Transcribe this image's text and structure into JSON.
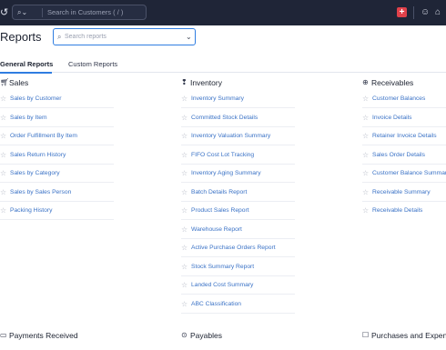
{
  "topbar": {
    "logo_icon": "app-logo-icon",
    "search_scope_icon": "search-icon",
    "search_placeholder": "Search in Customers ( / )",
    "add_label": "+",
    "users_icon": "users-icon",
    "bell_icon": "bell-icon"
  },
  "header": {
    "title": "Reports",
    "search_placeholder": "Search reports"
  },
  "tabs": [
    {
      "label": "General Reports",
      "active": true
    },
    {
      "label": "Custom Reports",
      "active": false
    }
  ],
  "sections": {
    "sales": {
      "title": "Sales",
      "icon": "cart-icon",
      "items": [
        "Sales by Customer",
        "Sales by Item",
        "Order Fulfillment By Item",
        "Sales Return History",
        "Sales by Category",
        "Sales by Sales Person",
        "Packing History"
      ]
    },
    "inventory": {
      "title": "Inventory",
      "icon": "tag-icon",
      "items": [
        "Inventory Summary",
        "Committed Stock Details",
        "Inventory Valuation Summary",
        "FIFO Cost Lot Tracking",
        "Inventory Aging Summary",
        "Batch Details Report",
        "Product Sales Report",
        "Warehouse Report",
        "Active Purchase Orders Report",
        "Stock Summary Report",
        "Landed Cost Summary",
        "ABC Classification"
      ]
    },
    "receivables": {
      "title": "Receivables",
      "icon": "receivables-icon",
      "items": [
        "Customer Balances",
        "Invoice Details",
        "Retainer Invoice Details",
        "Sales Order Details",
        "Customer Balance Summary",
        "Receivable Summary",
        "Receivable Details"
      ]
    }
  },
  "bottom_sections": [
    {
      "title": "Payments Received",
      "icon": "payment-card-icon"
    },
    {
      "title": "Payables",
      "icon": "payables-icon"
    },
    {
      "title": "Purchases and Expenses",
      "icon": "shopping-bag-icon"
    }
  ],
  "colors": {
    "topbar_bg": "#1f2537",
    "accent": "#2f7de1",
    "link": "#3a72c6",
    "add_button": "#e0414a"
  }
}
